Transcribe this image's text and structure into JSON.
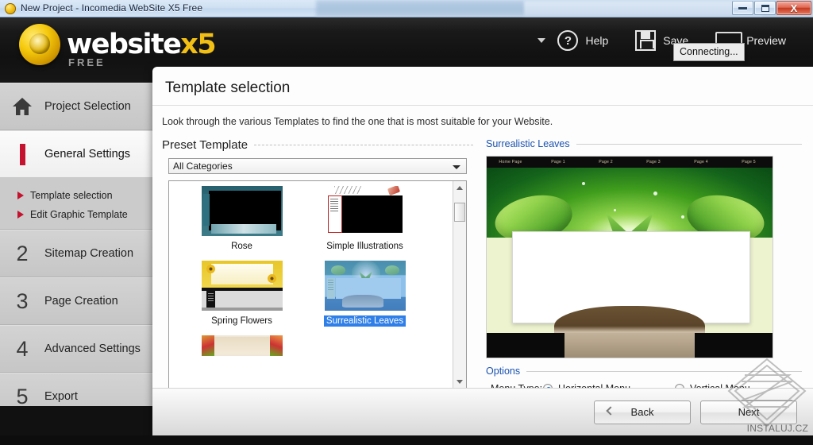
{
  "window": {
    "title": "New Project - Incomedia WebSite X5 Free",
    "app_icon": "app-circle-icon",
    "controls": {
      "minimize": "minimize-icon",
      "maximize": "maximize-icon",
      "close": "X"
    }
  },
  "header": {
    "logo": {
      "word": "website",
      "x5": "x5",
      "free": "FREE"
    },
    "tools": [
      {
        "id": "help",
        "label": "Help",
        "icon": "question-mark-icon"
      },
      {
        "id": "save",
        "label": "Save",
        "icon": "floppy-disk-icon"
      },
      {
        "id": "preview",
        "label": "Preview",
        "icon": "monitor-icon"
      }
    ],
    "tooltip": "Connecting..."
  },
  "sidebar": {
    "items": [
      {
        "num": "",
        "icon": "home-icon",
        "label": "Project Selection",
        "active": false
      },
      {
        "num": "1",
        "icon": "red-bar-icon",
        "label": "General Settings",
        "active": true
      },
      {
        "num": "2",
        "icon": "",
        "label": "Sitemap Creation",
        "active": false
      },
      {
        "num": "3",
        "icon": "",
        "label": "Page Creation",
        "active": false
      },
      {
        "num": "4",
        "icon": "",
        "label": "Advanced Settings",
        "active": false
      },
      {
        "num": "5",
        "icon": "",
        "label": "Export",
        "active": false
      }
    ],
    "subitems": [
      {
        "label": "Template selection"
      },
      {
        "label": "Edit Graphic Template"
      }
    ]
  },
  "dialog": {
    "title": "Template selection",
    "description": "Look through the various Templates to find the one that is most suitable for your Website.",
    "preset_group_label": "Preset Template",
    "category_select": {
      "value": "All Categories"
    },
    "templates": [
      {
        "name": "Rose",
        "thumb": "th-rose",
        "selected": false
      },
      {
        "name": "Simple Illustrations",
        "thumb": "th-simple",
        "selected": false
      },
      {
        "name": "Spring Flowers",
        "thumb": "th-spring",
        "selected": false
      },
      {
        "name": "Surrealistic Leaves",
        "thumb": "th-leaves",
        "selected": true
      },
      {
        "name": "",
        "thumb": "th-food",
        "selected": false
      }
    ],
    "preview": {
      "label": "Surrealistic Leaves",
      "nav": [
        "Home Page",
        "Page 1",
        "Page 2",
        "Page 3",
        "Page 4",
        "Page 5"
      ]
    },
    "options_label": "Options",
    "menu_type_label": "Menu Type:",
    "menu_type_options": [
      {
        "label": "Horizontal Menu",
        "selected": true
      },
      {
        "label": "Vertical Menu",
        "selected": false
      }
    ],
    "buttons": {
      "back": "Back",
      "next": "Next"
    }
  },
  "watermark": {
    "text": "INSTALUJ.CZ"
  },
  "colors": {
    "accent_red": "#c4122f",
    "logo_gold": "#f2c014",
    "select_blue": "#2f7fe8",
    "link_blue": "#1a53b0",
    "dialog_bottom": "#7d0f23"
  }
}
